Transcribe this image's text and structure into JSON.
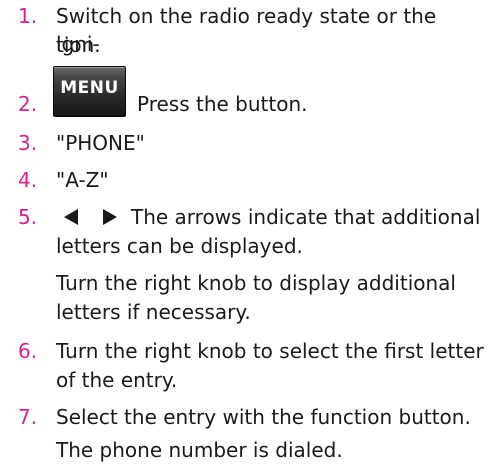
{
  "number_color": "#d62290",
  "steps": [
    {
      "number": "1.",
      "lines": [
        "Switch on the radio ready state or the igni-",
        "tion."
      ]
    },
    {
      "number": "2.",
      "button_label": "MENU",
      "text": "Press the button."
    },
    {
      "number": "3.",
      "text": "\"PHONE\""
    },
    {
      "number": "4.",
      "text": "\"A-Z\""
    },
    {
      "number": "5.",
      "icons": [
        "arrow-left-icon",
        "arrow-right-icon"
      ],
      "lines": [
        "The arrows indicate that additional",
        "letters can be displayed."
      ],
      "note_lines": [
        "Turn the right knob to display additional",
        "letters if necessary."
      ]
    },
    {
      "number": "6.",
      "lines": [
        "Turn the right knob to select the first letter",
        "of the entry."
      ]
    },
    {
      "number": "7.",
      "text": "Select the entry with the function button.",
      "note": "The phone number is dialed."
    }
  ]
}
